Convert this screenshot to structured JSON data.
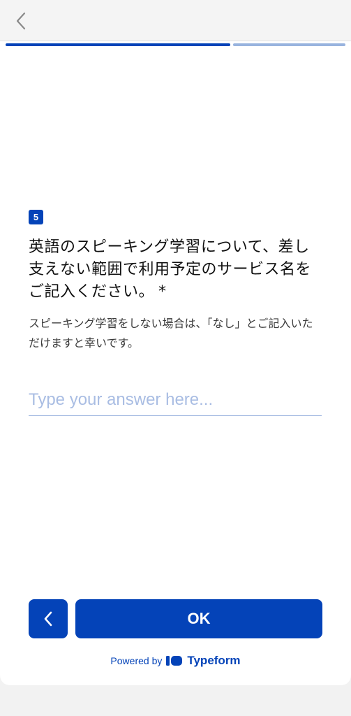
{
  "colors": {
    "accent": "#0443b8",
    "progress_track": "#98b3de",
    "placeholder": "#a9bde3"
  },
  "header": {
    "back_icon": "chevron-left-icon"
  },
  "progress": {
    "fraction_complete": 0.67
  },
  "question": {
    "number": "5",
    "text": "英語のスピーキング学習について、差し支えない範囲で利用予定のサービス名をご記入ください。",
    "required_mark": "*",
    "description": "スピーキング学習をしない場合は、「なし」とご記入いただけますと幸いです。"
  },
  "answer": {
    "placeholder": "Type your answer here...",
    "value": ""
  },
  "buttons": {
    "back_icon": "chevron-left-icon",
    "ok_label": "OK"
  },
  "footer": {
    "powered_by": "Powered by",
    "brand": "Typeform",
    "logo_icon": "typeform-logo-icon"
  }
}
